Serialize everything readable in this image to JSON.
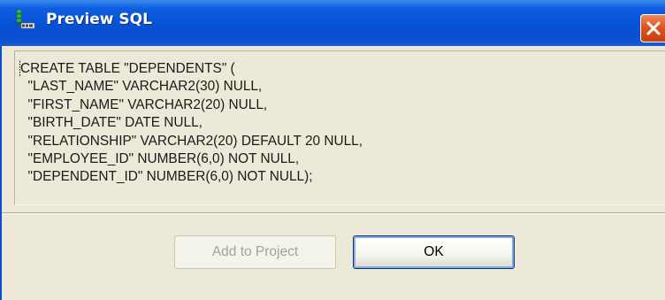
{
  "window": {
    "title": "Preview SQL"
  },
  "icons": {
    "app": "database-table-icon",
    "close": "close-icon"
  },
  "sql": {
    "lines": [
      "CREATE TABLE \"DEPENDENTS\" (",
      "  \"LAST_NAME\" VARCHAR2(30) NULL,",
      "  \"FIRST_NAME\" VARCHAR2(20) NULL,",
      "  \"BIRTH_DATE\" DATE NULL,",
      "  \"RELATIONSHIP\" VARCHAR2(20) DEFAULT 20 NULL,",
      "  \"EMPLOYEE_ID\" NUMBER(6,0) NOT NULL,",
      "  \"DEPENDENT_ID\" NUMBER(6,0) NOT NULL);"
    ]
  },
  "buttons": {
    "add_to_project": "Add to Project",
    "add_to_project_enabled": false,
    "ok": "OK"
  },
  "colors": {
    "titlebar": "#0a4fd0",
    "dialog_face": "#ece9d8",
    "close_button": "#e0541e"
  }
}
